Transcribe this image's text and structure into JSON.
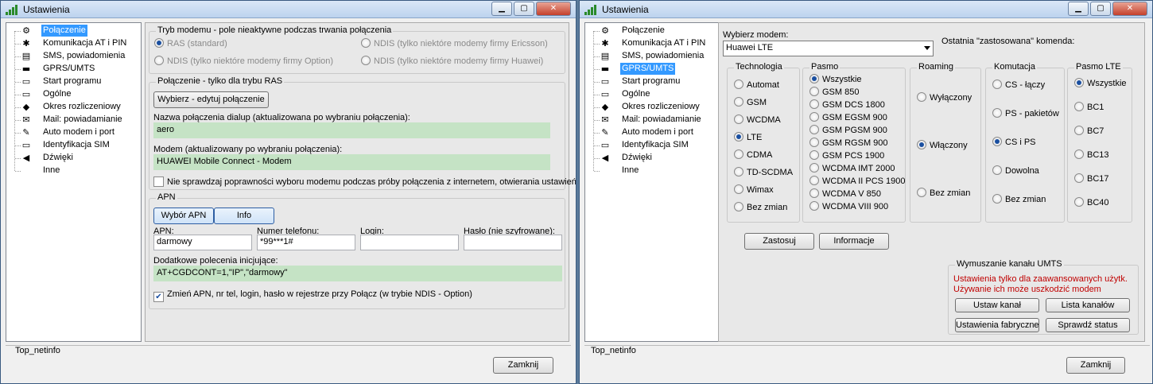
{
  "window1": {
    "title": "Ustawienia",
    "tree": [
      {
        "label": "Połączenie",
        "icon": "gear-icon",
        "glyph": "⚙",
        "selected": true
      },
      {
        "label": "Komunikacja AT i PIN",
        "icon": "network-icon",
        "glyph": "✱"
      },
      {
        "label": "SMS, powiadomienia",
        "icon": "sms-icon",
        "glyph": "▤"
      },
      {
        "label": "GPRS/UMTS",
        "icon": "car-icon",
        "glyph": "▬"
      },
      {
        "label": "Start programu",
        "icon": "computer-icon",
        "glyph": "▭"
      },
      {
        "label": "Ogólne",
        "icon": "computer-icon",
        "glyph": "▭"
      },
      {
        "label": "Okres rozliczeniowy",
        "icon": "money-icon",
        "glyph": "◆"
      },
      {
        "label": "Mail: powiadamianie",
        "icon": "mail-icon",
        "glyph": "✉"
      },
      {
        "label": "Auto modem i port",
        "icon": "notepad-icon",
        "glyph": "✎"
      },
      {
        "label": "Identyfikacja SIM",
        "icon": "computer-icon",
        "glyph": "▭"
      },
      {
        "label": "Dźwięki",
        "icon": "speaker-icon",
        "glyph": "◀"
      },
      {
        "label": "Inne",
        "icon": "blank-icon",
        "glyph": ""
      }
    ],
    "modem_mode": {
      "title": "Tryb modemu - pole nieaktywne podczas trwania połączenia",
      "ras": "RAS (standard)",
      "ndis_ericsson": "NDIS (tylko niektóre modemy firmy Ericsson)",
      "ndis_option": "NDIS (tylko niektóre modemy firmy Option)",
      "ndis_huawei": "NDIS (tylko niektóre modemy firmy Huawei)"
    },
    "ras_conn": {
      "title": "Połączenie - tylko dla trybu RAS",
      "edit_button": "Wybierz - edytuj połączenie",
      "dialup_label": "Nazwa połączenia dialup (aktualizowana po wybraniu połączenia):",
      "dialup_value": "aero",
      "modem_label": "Modem (aktualizowany po wybraniu połączenia):",
      "modem_value": "HUAWEI Mobile Connect - Modem",
      "check_label": "Nie sprawdzaj poprawności wyboru modemu podczas próby połączenia z internetem, otwierania ustawień"
    },
    "apn": {
      "title": "APN",
      "select_button": "Wybór APN",
      "info_button": "Info",
      "apn_label": "APN:",
      "apn_value": "darmowy",
      "phone_label": "Numer telefonu:",
      "phone_value": "*99***1#",
      "login_label": "Login:",
      "login_value": "",
      "password_label": "Hasło (nie szyfrowane):",
      "password_value": "",
      "init_label": "Dodatkowe polecenia inicjujące:",
      "init_value": "AT+CGDCONT=1,\"IP\",\"darmowy\"",
      "change_label": "Zmień APN, nr tel, login, hasło w rejestrze przy Połącz (w trybie NDIS - Option)"
    },
    "status": "Top_netinfo",
    "close_button": "Zamknij"
  },
  "window2": {
    "title": "Ustawienia",
    "tree": [
      {
        "label": "Połączenie",
        "icon": "gear-icon",
        "glyph": "⚙"
      },
      {
        "label": "Komunikacja AT i PIN",
        "icon": "network-icon",
        "glyph": "✱"
      },
      {
        "label": "SMS, powiadomienia",
        "icon": "sms-icon",
        "glyph": "▤"
      },
      {
        "label": "GPRS/UMTS",
        "icon": "car-icon",
        "glyph": "▬",
        "selected": true
      },
      {
        "label": "Start programu",
        "icon": "computer-icon",
        "glyph": "▭"
      },
      {
        "label": "Ogólne",
        "icon": "computer-icon",
        "glyph": "▭"
      },
      {
        "label": "Okres rozliczeniowy",
        "icon": "money-icon",
        "glyph": "◆"
      },
      {
        "label": "Mail: powiadamianie",
        "icon": "mail-icon",
        "glyph": "✉"
      },
      {
        "label": "Auto modem i port",
        "icon": "notepad-icon",
        "glyph": "✎"
      },
      {
        "label": "Identyfikacja SIM",
        "icon": "computer-icon",
        "glyph": "▭"
      },
      {
        "label": "Dźwięki",
        "icon": "speaker-icon",
        "glyph": "◀"
      },
      {
        "label": "Inne",
        "icon": "blank-icon",
        "glyph": ""
      }
    ],
    "modem_label": "Wybierz modem:",
    "modem_value": "Huawei LTE",
    "last_command_label": "Ostatnia \"zastosowana\" komenda:",
    "technology": {
      "title": "Technologia",
      "options": [
        "Automat",
        "GSM",
        "WCDMA",
        "LTE",
        "CDMA",
        "TD-SCDMA",
        "Wimax",
        "Bez zmian"
      ],
      "selected": 3
    },
    "band": {
      "title": "Pasmo",
      "options": [
        "Wszystkie",
        "GSM 850",
        "GSM DCS 1800",
        "GSM EGSM 900",
        "GSM PGSM 900",
        "GSM RGSM 900",
        "GSM PCS 1900",
        "WCDMA IMT 2000",
        "WCDMA II PCS 1900",
        "WCDMA V 850",
        "WCDMA VIII 900"
      ],
      "selected": 0
    },
    "roaming": {
      "title": "Roaming",
      "options": [
        "Wyłączony",
        "Włączony",
        "Bez zmian"
      ],
      "selected": 1
    },
    "switching": {
      "title": "Komutacja",
      "options": [
        "CS - łączy",
        "PS - pakietów",
        "CS i PS",
        "Dowolna",
        "Bez zmian"
      ],
      "selected": 2
    },
    "lte_band": {
      "title": "Pasmo LTE",
      "options": [
        "Wszystkie",
        "BC1",
        "BC7",
        "BC13",
        "BC17",
        "BC40"
      ],
      "selected": 0
    },
    "apply_button": "Zastosuj",
    "info_button": "Informacje",
    "umts": {
      "title": "Wymuszanie kanału UMTS",
      "warning1": "Ustawienia tylko dla zaawansowanych użytk.",
      "warning2": "Używanie ich może uszkodzić modem",
      "set_channel": "Ustaw kanał",
      "channel_list": "Lista kanałów",
      "factory": "Ustawienia fabryczne",
      "check_status": "Sprawdź status"
    },
    "status": "Top_netinfo",
    "close_button": "Zamknij"
  },
  "colors": {
    "selection": "#3399ff",
    "field_green": "#c5e3c5",
    "warning": "#c00000"
  }
}
